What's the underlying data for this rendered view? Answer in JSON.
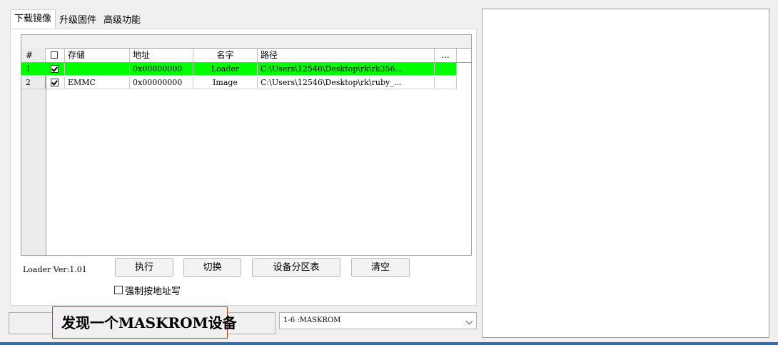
{
  "tabs": [
    {
      "label": "下载镜像",
      "active": true
    },
    {
      "label": "升级固件",
      "active": false
    },
    {
      "label": "高级功能",
      "active": false
    }
  ],
  "grid": {
    "headers": {
      "num": "#",
      "store": "存储",
      "addr": "地址",
      "name": "名字",
      "path": "路径",
      "more": "..."
    },
    "rows": [
      {
        "num": "1",
        "checked": true,
        "store": "",
        "addr": "0x00000000",
        "name": "Loader",
        "path": "C:\\Users\\12546\\Desktop\\rk\\rk356...",
        "selected": true
      },
      {
        "num": "2",
        "checked": true,
        "store": "EMMC",
        "addr": "0x00000000",
        "name": "Image",
        "path": "C:\\Users\\12546\\Desktop\\rk\\ruby_...",
        "selected": false
      }
    ]
  },
  "loader_version": "Loader Ver:1.01",
  "buttons": {
    "execute": "执行",
    "switch": "切换",
    "partition": "设备分区表",
    "clear": "清空"
  },
  "force_write": {
    "label": "强制按地址写",
    "checked": false
  },
  "status": {
    "message": "发现一个MASKROM设备"
  },
  "device_select": {
    "value": "1-6 :MASKROM"
  },
  "colors": {
    "selected_row": "#00ff00",
    "highlight_border": "#e0302a",
    "accent": "#2f6fb5"
  }
}
